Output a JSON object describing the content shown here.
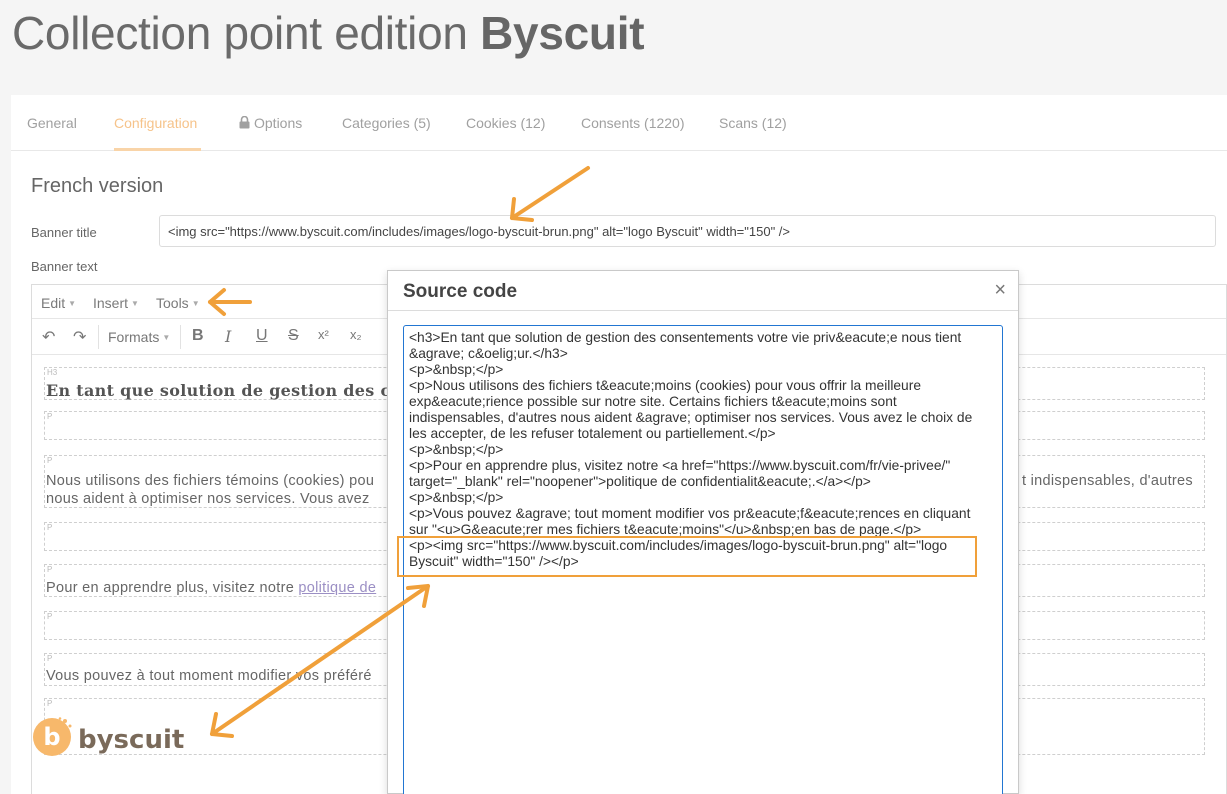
{
  "page": {
    "title_prefix": "Collection point edition ",
    "title_brand": "Byscuit"
  },
  "tabs": [
    {
      "label": "General"
    },
    {
      "label": "Configuration"
    },
    {
      "label": "Options"
    },
    {
      "label": "Categories (5)"
    },
    {
      "label": "Cookies (12)"
    },
    {
      "label": "Consents (1220)"
    },
    {
      "label": "Scans (12)"
    }
  ],
  "form": {
    "section_title": "French version",
    "banner_title_label": "Banner title",
    "banner_title_value": "<img src=\"https://www.byscuit.com/includes/images/logo-byscuit-brun.png\" alt=\"logo Byscuit\" width=\"150\" />",
    "banner_text_label": "Banner text"
  },
  "editor": {
    "menu": [
      "Edit",
      "Insert",
      "Tools"
    ],
    "formats_label": "Formats",
    "blocks": {
      "heading": "En tant que solution de gestion des co",
      "para1_line1": "Nous utilisons des fichiers témoins (cookies) pou",
      "para1_line2": "nous aident à optimiser nos services. Vous avez",
      "para1_right": "t indispensables, d'autres",
      "para2_prefix": "Pour en apprendre plus, visitez notre ",
      "para2_link": "politique de",
      "para3": "Vous pouvez à tout moment modifier vos préféré"
    },
    "logo_text": "byscuit",
    "logo_letter": "b"
  },
  "modal": {
    "title": "Source code",
    "close": "×",
    "code": "<h3>En tant que solution de gestion des consentements votre vie priv&eacute;e nous tient\n&agrave; c&oelig;ur.</h3>\n<p>&nbsp;</p>\n<p>Nous utilisons des fichiers t&eacute;moins (cookies) pour vous offrir la meilleure\nexp&eacute;rience possible sur notre site. Certains fichiers t&eacute;moins sont\nindispensables, d'autres nous aident &agrave; optimiser nos services. Vous avez le choix de\nles accepter, de les refuser totalement ou partiellement.</p>\n<p>&nbsp;</p>\n<p>Pour en apprendre plus, visitez notre <a href=\"https://www.byscuit.com/fr/vie-privee/\"\ntarget=\"_blank\" rel=\"noopener\">politique de confidentialit&eacute;.</a></p>\n<p>&nbsp;</p>\n<p>Vous pouvez &agrave; tout moment modifier vos pr&eacute;f&eacute;rences en cliquant\nsur \"<u>G&eacute;rer mes fichiers t&eacute;moins\"</u>&nbsp;en bas de page.</p>\n<p><img src=\"https://www.byscuit.com/includes/images/logo-byscuit-brun.png\" alt=\"logo\nByscuit\" width=\"150\" /></p>"
  },
  "colors": {
    "accent": "#f0a03a",
    "tab_active": "#f6c38a",
    "code_border": "#2276d2",
    "logo": "#f7b86b"
  }
}
